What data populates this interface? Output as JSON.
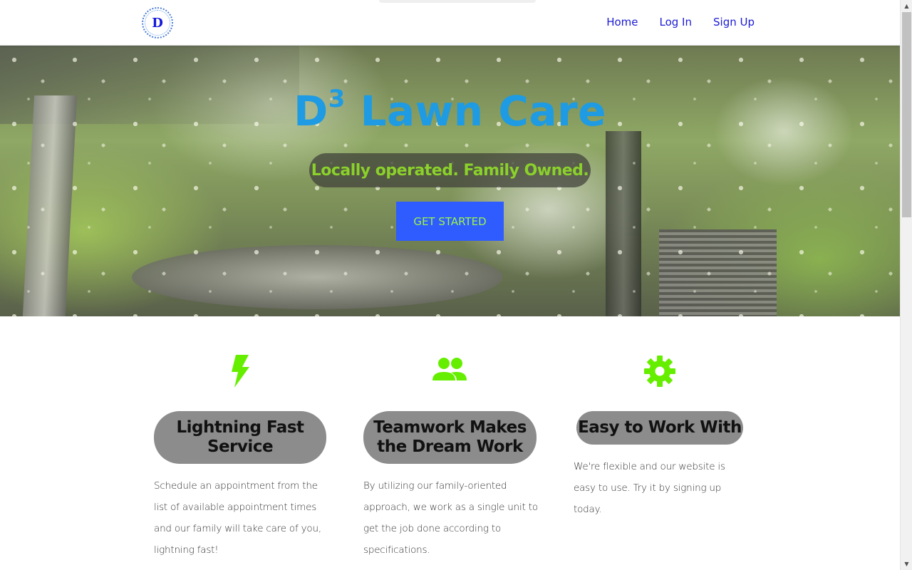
{
  "brand": {
    "logo_letter": "D"
  },
  "nav": {
    "links": [
      "Home",
      "Log In",
      "Sign Up"
    ]
  },
  "hero": {
    "title_main": "D",
    "title_sup": "3",
    "title_rest": " Lawn Care",
    "tagline": "Locally operated. Family Owned.",
    "cta_label": "GET STARTED"
  },
  "features": [
    {
      "icon": "lightning-bolt-icon",
      "title": "Lightning Fast Service",
      "description": "Schedule an appointment from the list of available appointment times and our family will take care of you, lightning fast!"
    },
    {
      "icon": "people-icon",
      "title": "Teamwork Makes the Dream Work",
      "description": "By utilizing our family-oriented approach, we work as a single unit to get the job done according to specifications."
    },
    {
      "icon": "gear-icon",
      "title": "Easy to Work With",
      "description": "We're flexible and our website is easy to use. Try it by signing up today."
    }
  ],
  "colors": {
    "accent_green": "#66ee00",
    "title_blue": "#1e9be2",
    "cta_blue": "#2f5cff",
    "nav_link": "#1a1ad6"
  }
}
